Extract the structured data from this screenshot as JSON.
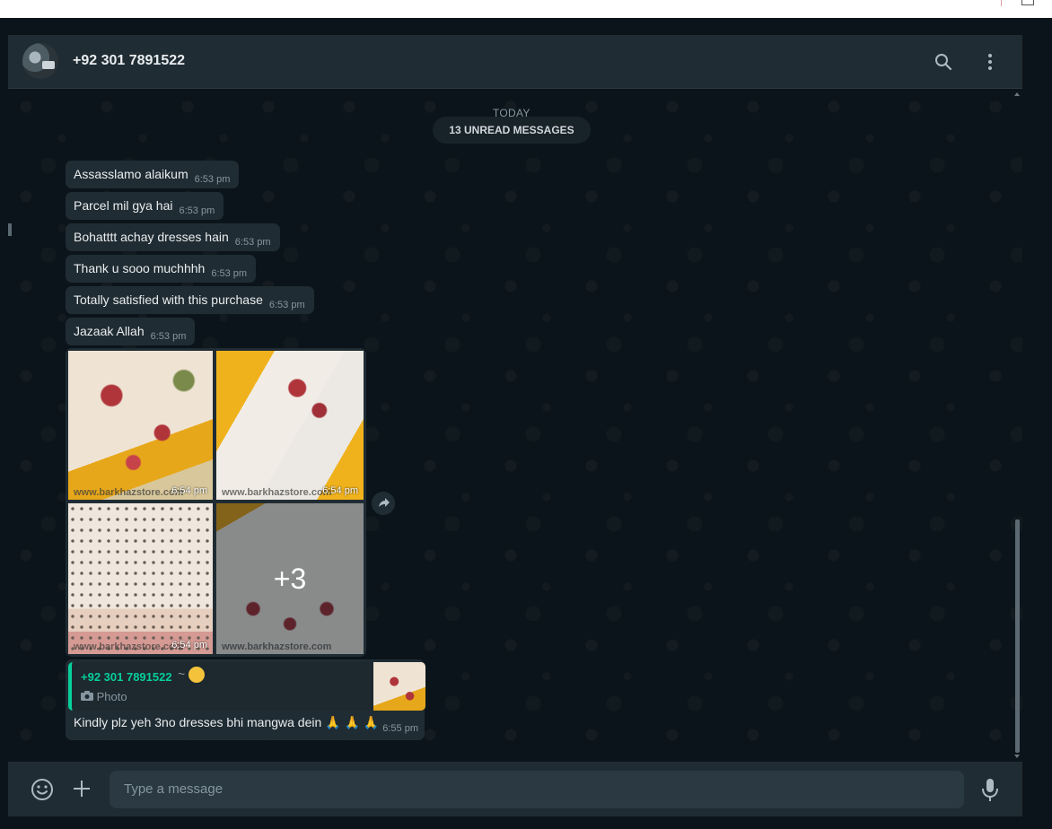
{
  "header": {
    "contact_name": "+92 301 7891522"
  },
  "chat": {
    "date_label": "TODAY",
    "unread_label": "13 UNREAD MESSAGES",
    "messages": [
      {
        "text": "Assasslamo alaikum",
        "time": "6:53 pm"
      },
      {
        "text": "Parcel mil gya hai",
        "time": "6:53 pm"
      },
      {
        "text": "Bohatttt achay dresses hain",
        "time": "6:53 pm"
      },
      {
        "text": "Thank u sooo muchhhh",
        "time": "6:53 pm"
      },
      {
        "text": "Totally satisfied with this purchase",
        "time": "6:53 pm"
      },
      {
        "text": "Jazaak Allah",
        "time": "6:53 pm"
      }
    ],
    "media": {
      "images": [
        {
          "time": "6:54 pm",
          "watermark": "www.barkhazstore.com"
        },
        {
          "time": "6:54 pm",
          "watermark": "www.barkhazstore.com"
        },
        {
          "time": "6:54 pm",
          "watermark": "www.barkhazstore.com"
        },
        {
          "more_count": "+3",
          "watermark": "www.barkhazstore.com"
        }
      ]
    },
    "reply": {
      "quoted_author": "+92 301 7891522",
      "quoted_suffix": "~",
      "quoted_type": "Photo",
      "text": "Kindly plz yeh 3no dresses bhi mangwa dein 🙏 🙏 🙏",
      "time": "6:55 pm"
    }
  },
  "composer": {
    "placeholder": "Type a message"
  },
  "colors": {
    "accent": "#06cf9c",
    "panel": "#202c33",
    "background": "#0b141a",
    "input": "#2a3942"
  },
  "icons": [
    "avatar",
    "search-icon",
    "menu-icon",
    "forward-icon",
    "emoji-icon",
    "plus-icon",
    "camera-icon",
    "mic-icon"
  ]
}
